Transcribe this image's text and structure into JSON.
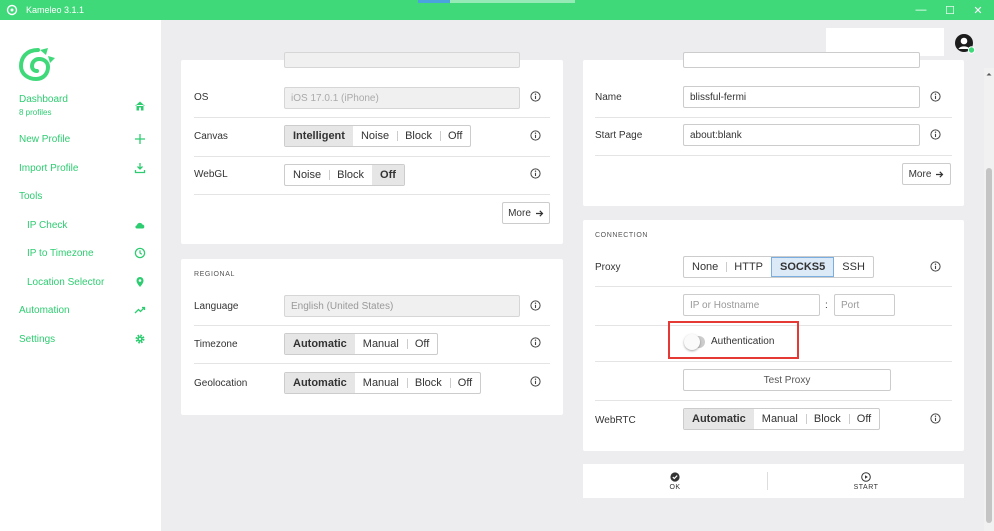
{
  "titlebar": {
    "title": "Kameleo 3.1.1",
    "minimize": "—",
    "maximize": "☐",
    "close": "✕"
  },
  "sidebar": {
    "dashboard": {
      "label": "Dashboard",
      "sub": "8 profiles"
    },
    "new_profile": "New Profile",
    "import_profile": "Import Profile",
    "tools": "Tools",
    "ip_check": "IP Check",
    "ip_to_timezone": "IP to Timezone",
    "location_selector": "Location Selector",
    "automation": "Automation",
    "settings": "Settings"
  },
  "fingerprint": {
    "os": {
      "label": "OS",
      "value": "iOS 17.0.1 (iPhone)"
    },
    "canvas": {
      "label": "Canvas",
      "options": [
        "Intelligent",
        "Noise",
        "Block",
        "Off"
      ],
      "selected": "Intelligent"
    },
    "webgl": {
      "label": "WebGL",
      "options": [
        "Noise",
        "Block",
        "Off"
      ],
      "selected": "Off"
    },
    "more": "More"
  },
  "regional": {
    "title": "REGIONAL",
    "language": {
      "label": "Language",
      "placeholder": "English (United States)"
    },
    "timezone": {
      "label": "Timezone",
      "options": [
        "Automatic",
        "Manual",
        "Off"
      ],
      "selected": "Automatic"
    },
    "geolocation": {
      "label": "Geolocation",
      "options": [
        "Automatic",
        "Manual",
        "Block",
        "Off"
      ],
      "selected": "Automatic"
    }
  },
  "general": {
    "name": {
      "label": "Name",
      "value": "blissful-fermi"
    },
    "start_page": {
      "label": "Start Page",
      "value": "about:blank"
    },
    "more": "More"
  },
  "connection": {
    "title": "CONNECTION",
    "proxy": {
      "label": "Proxy",
      "options": [
        "None",
        "HTTP",
        "SOCKS5",
        "SSH"
      ],
      "selected": "SOCKS5"
    },
    "host_placeholder": "IP or Hostname",
    "colon": ":",
    "port_placeholder": "Port",
    "authentication": "Authentication",
    "test_proxy": "Test Proxy",
    "webrtc": {
      "label": "WebRTC",
      "options": [
        "Automatic",
        "Manual",
        "Block",
        "Off"
      ],
      "selected": "Automatic"
    }
  },
  "footer": {
    "ok": "OK",
    "start": "START"
  },
  "colors": {
    "brand": "#3fd97a",
    "accent_text": "#2ecc71",
    "highlight": "#e53935"
  }
}
